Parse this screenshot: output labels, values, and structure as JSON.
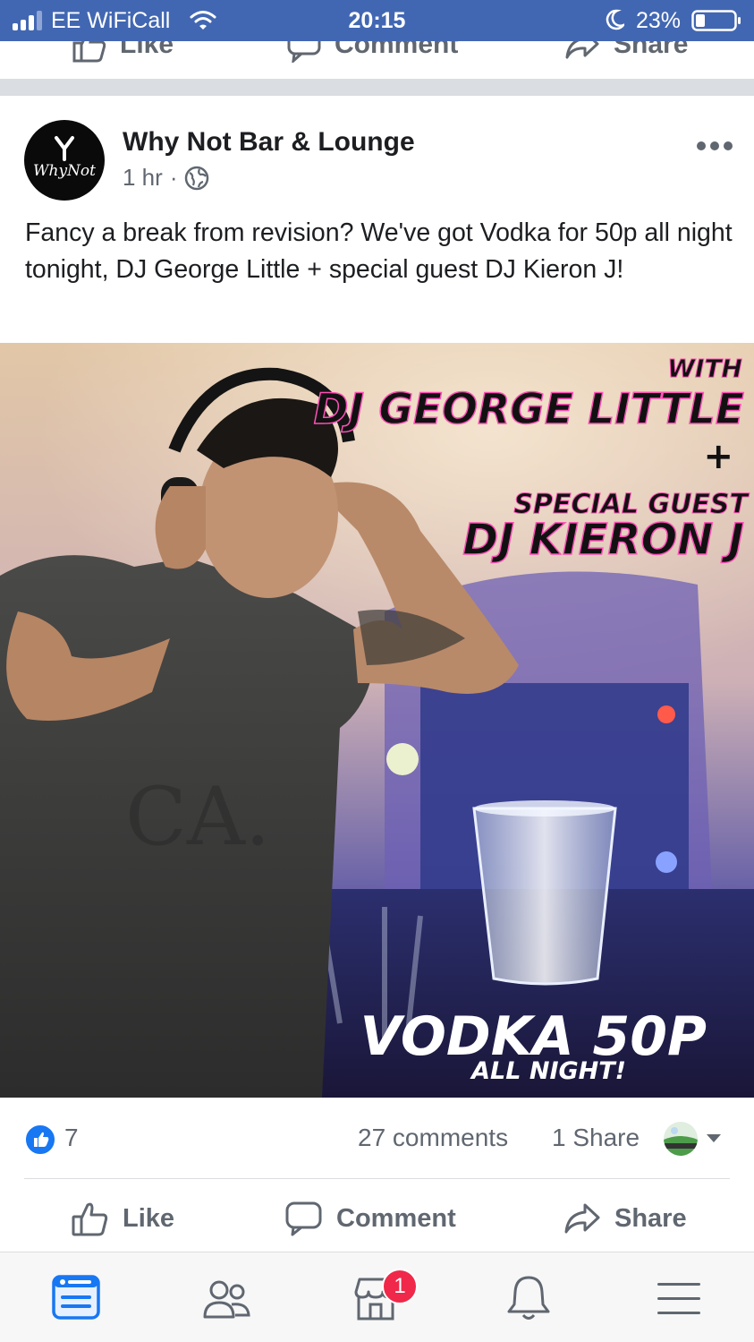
{
  "status_bar": {
    "carrier": "EE WiFiCall",
    "time": "20:15",
    "battery": "23%"
  },
  "previous_post": {
    "like_label": "Like",
    "comment_label": "Comment",
    "share_label": "Share"
  },
  "post": {
    "page_name": "Why Not Bar & Lounge",
    "avatar_text": "WhyNot",
    "time": "1 hr",
    "separator": "·",
    "privacy_icon": "globe-icon",
    "text": "Fancy a break from revision? We've got Vodka for 50p all night tonight, DJ George Little + special guest DJ Kieron J!",
    "image": {
      "with": "WITH",
      "dj1": "DJ GEORGE LITTLE",
      "plus": "+",
      "special_guest": "SPECIAL GUEST",
      "dj2": "DJ KIERON J",
      "offer": "VODKA 50P",
      "offer_sub": "ALL NIGHT!"
    },
    "reactions": {
      "like_count": "7",
      "comments": "27 comments",
      "shares": "1 Share"
    },
    "actions": {
      "like_label": "Like",
      "comment_label": "Comment",
      "share_label": "Share"
    }
  },
  "bottom_nav": {
    "items": [
      "news-feed-icon",
      "friends-icon",
      "marketplace-icon",
      "notifications-icon",
      "menu-icon"
    ],
    "badge": "1"
  },
  "colors": {
    "facebook_blue": "#4267b2",
    "like_blue": "#1877f2",
    "gray_text": "#606770",
    "badge_red": "#f02849"
  }
}
